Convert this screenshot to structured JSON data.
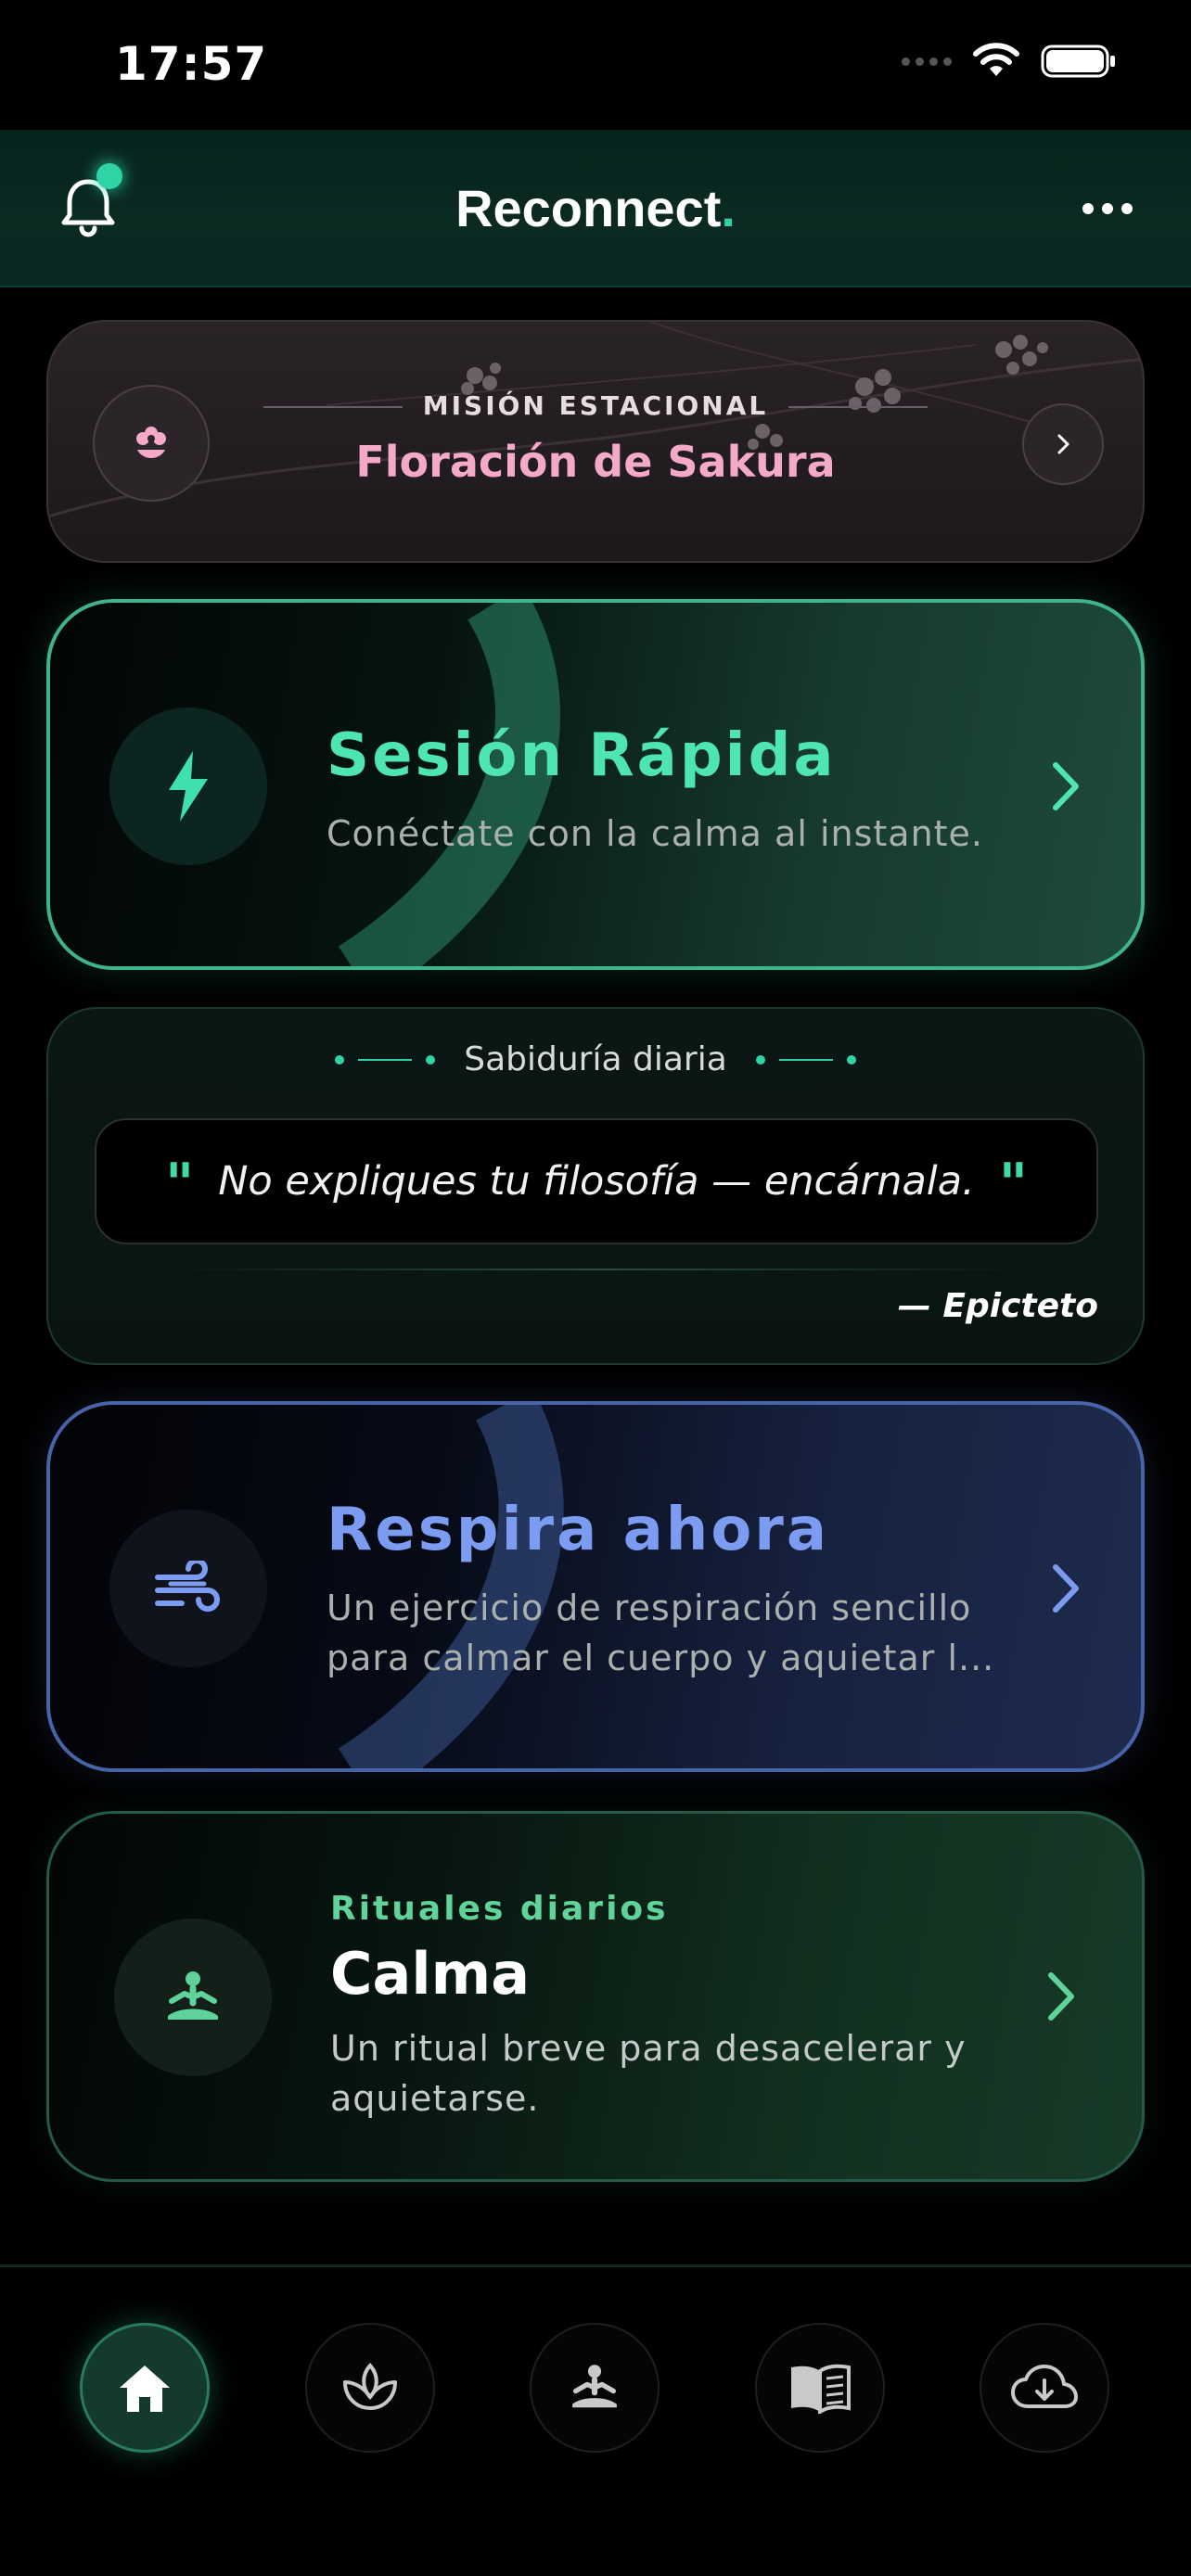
{
  "status_bar": {
    "time": "17:57"
  },
  "header": {
    "brand": "Reconnect",
    "brand_dot": "."
  },
  "mission": {
    "eyebrow": "MISIÓN ESTACIONAL",
    "title": "Floración de Sakura"
  },
  "quick_session": {
    "title": "Sesión Rápida",
    "subtitle": "Conéctate con la calma al instante."
  },
  "wisdom": {
    "heading": "Sabiduría diaria",
    "quote": "No expliques tu filosofía — encárnala.",
    "author": "— Epicteto"
  },
  "breathe": {
    "title": "Respira ahora",
    "subtitle_line1": "Un ejercicio de respiración sencillo",
    "subtitle_line2": "para calmar el cuerpo y aquietar l..."
  },
  "ritual": {
    "eyebrow": "Rituales diarios",
    "title": "Calma",
    "subtitle_line1": "Un ritual breve para desacelerar y",
    "subtitle_line2": "aquietarse."
  },
  "nav": {
    "items": [
      {
        "icon": "home-icon",
        "active": true
      },
      {
        "icon": "sprout-icon",
        "active": false
      },
      {
        "icon": "meditation-icon",
        "active": false
      },
      {
        "icon": "book-icon",
        "active": false
      },
      {
        "icon": "cloud-download-icon",
        "active": false
      }
    ]
  },
  "colors": {
    "accent": "#2fd3a6",
    "quick_border": "#3fb38e",
    "breathe_accent": "#7b9cf0",
    "ritual_accent": "#5fd39a",
    "sakura": "#f4a9c6"
  }
}
